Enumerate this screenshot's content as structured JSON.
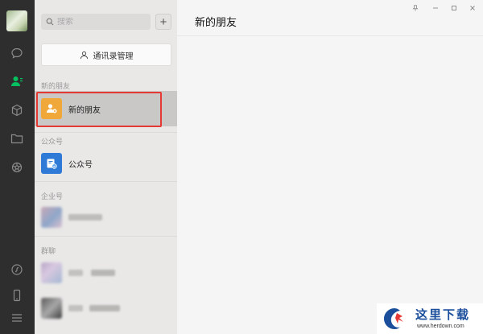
{
  "search": {
    "placeholder": "搜索"
  },
  "add_button": {
    "label": "+"
  },
  "manage_button": {
    "label": "通讯录管理"
  },
  "sections": {
    "new_friends": {
      "label": "新的朋友",
      "item": "新的朋友"
    },
    "official_accounts": {
      "label": "公众号",
      "item": "公众号"
    },
    "enterprise": {
      "label": "企业号"
    },
    "groups": {
      "label": "群聊"
    }
  },
  "main": {
    "title": "新的朋友"
  },
  "colors": {
    "accent_green": "#07c160",
    "new_friend_icon": "#f0a83a",
    "official_icon": "#2f7ad6",
    "highlight_red": "#e53935"
  },
  "watermark": {
    "title": "这里下载",
    "url": "www.herdown.com"
  }
}
